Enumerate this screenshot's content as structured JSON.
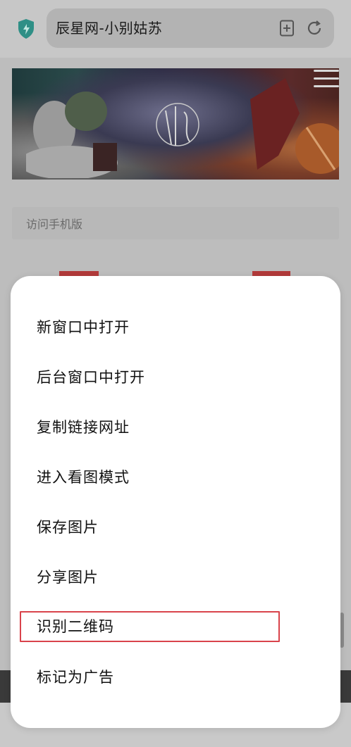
{
  "browser": {
    "page_title": "辰星网-小别姑苏"
  },
  "page": {
    "mobile_version_link": "访问手机版"
  },
  "context_menu": {
    "items": [
      {
        "id": "open-new-window",
        "label": "新窗口中打开"
      },
      {
        "id": "open-background-window",
        "label": "后台窗口中打开"
      },
      {
        "id": "copy-link",
        "label": "复制链接网址"
      },
      {
        "id": "image-view-mode",
        "label": "进入看图模式"
      },
      {
        "id": "save-image",
        "label": "保存图片"
      },
      {
        "id": "share-image",
        "label": "分享图片"
      },
      {
        "id": "scan-qr-code",
        "label": "识别二维码",
        "highlighted": true
      },
      {
        "id": "mark-as-ad",
        "label": "标记为广告"
      }
    ]
  },
  "colors": {
    "highlight": "#d9434b",
    "shield": "#2f8f86",
    "sheet": "#ffffff"
  }
}
